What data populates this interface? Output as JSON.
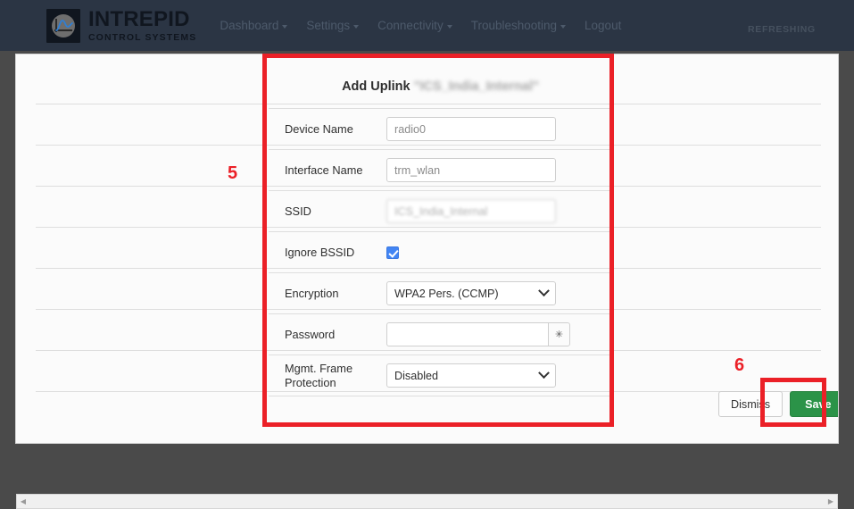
{
  "navbar": {
    "brand_name": "INTREPID",
    "brand_sub": "CONTROL SYSTEMS",
    "logo_icon": "intrepid-waveform-logo-icon",
    "links": [
      {
        "label": "Dashboard",
        "has_caret": true
      },
      {
        "label": "Settings",
        "has_caret": true
      },
      {
        "label": "Connectivity",
        "has_caret": true
      },
      {
        "label": "Troubleshooting",
        "has_caret": true
      },
      {
        "label": "Logout",
        "has_caret": false
      }
    ],
    "status": "REFRESHING"
  },
  "form": {
    "title_prefix": "Add Uplink ",
    "title_ssid": "\"ICS_India_Internal\"",
    "rows": {
      "device_name": {
        "label": "Device Name",
        "value": "radio0",
        "placeholder": "radio0"
      },
      "interface_name": {
        "label": "Interface Name",
        "value": "trm_wlan",
        "placeholder": "trm_wlan"
      },
      "ssid": {
        "label": "SSID",
        "value": "ICS_India_Internal",
        "placeholder": "ICS_India_Internal"
      },
      "ignore_bssid": {
        "label": "Ignore BSSID",
        "checked": "true"
      },
      "encryption": {
        "label": "Encryption",
        "value": "WPA2 Pers. (CCMP)",
        "options": [
          "WPA2 Pers. (CCMP)"
        ]
      },
      "password": {
        "label": "Password",
        "value": "",
        "placeholder": "",
        "toggle_glyph": "✳"
      },
      "mgmt_frame_protection": {
        "label": "Mgmt. Frame Protection",
        "value": "Disabled",
        "options": [
          "Disabled"
        ]
      }
    }
  },
  "actions": {
    "dismiss_label": "Dismiss",
    "save_label": "Save"
  },
  "annotations": {
    "step_5": "5",
    "step_6": "6"
  },
  "scrollbar": {
    "left_arrow": "◀",
    "right_arrow": "▶"
  },
  "colors": {
    "navbar_bg": "#2b3544",
    "annotation_red": "#eb2027",
    "save_green": "#2b9348",
    "checkbox_blue": "#4285f4",
    "page_bg": "#fbfbfb",
    "frame_grey": "#4a4a4a"
  }
}
